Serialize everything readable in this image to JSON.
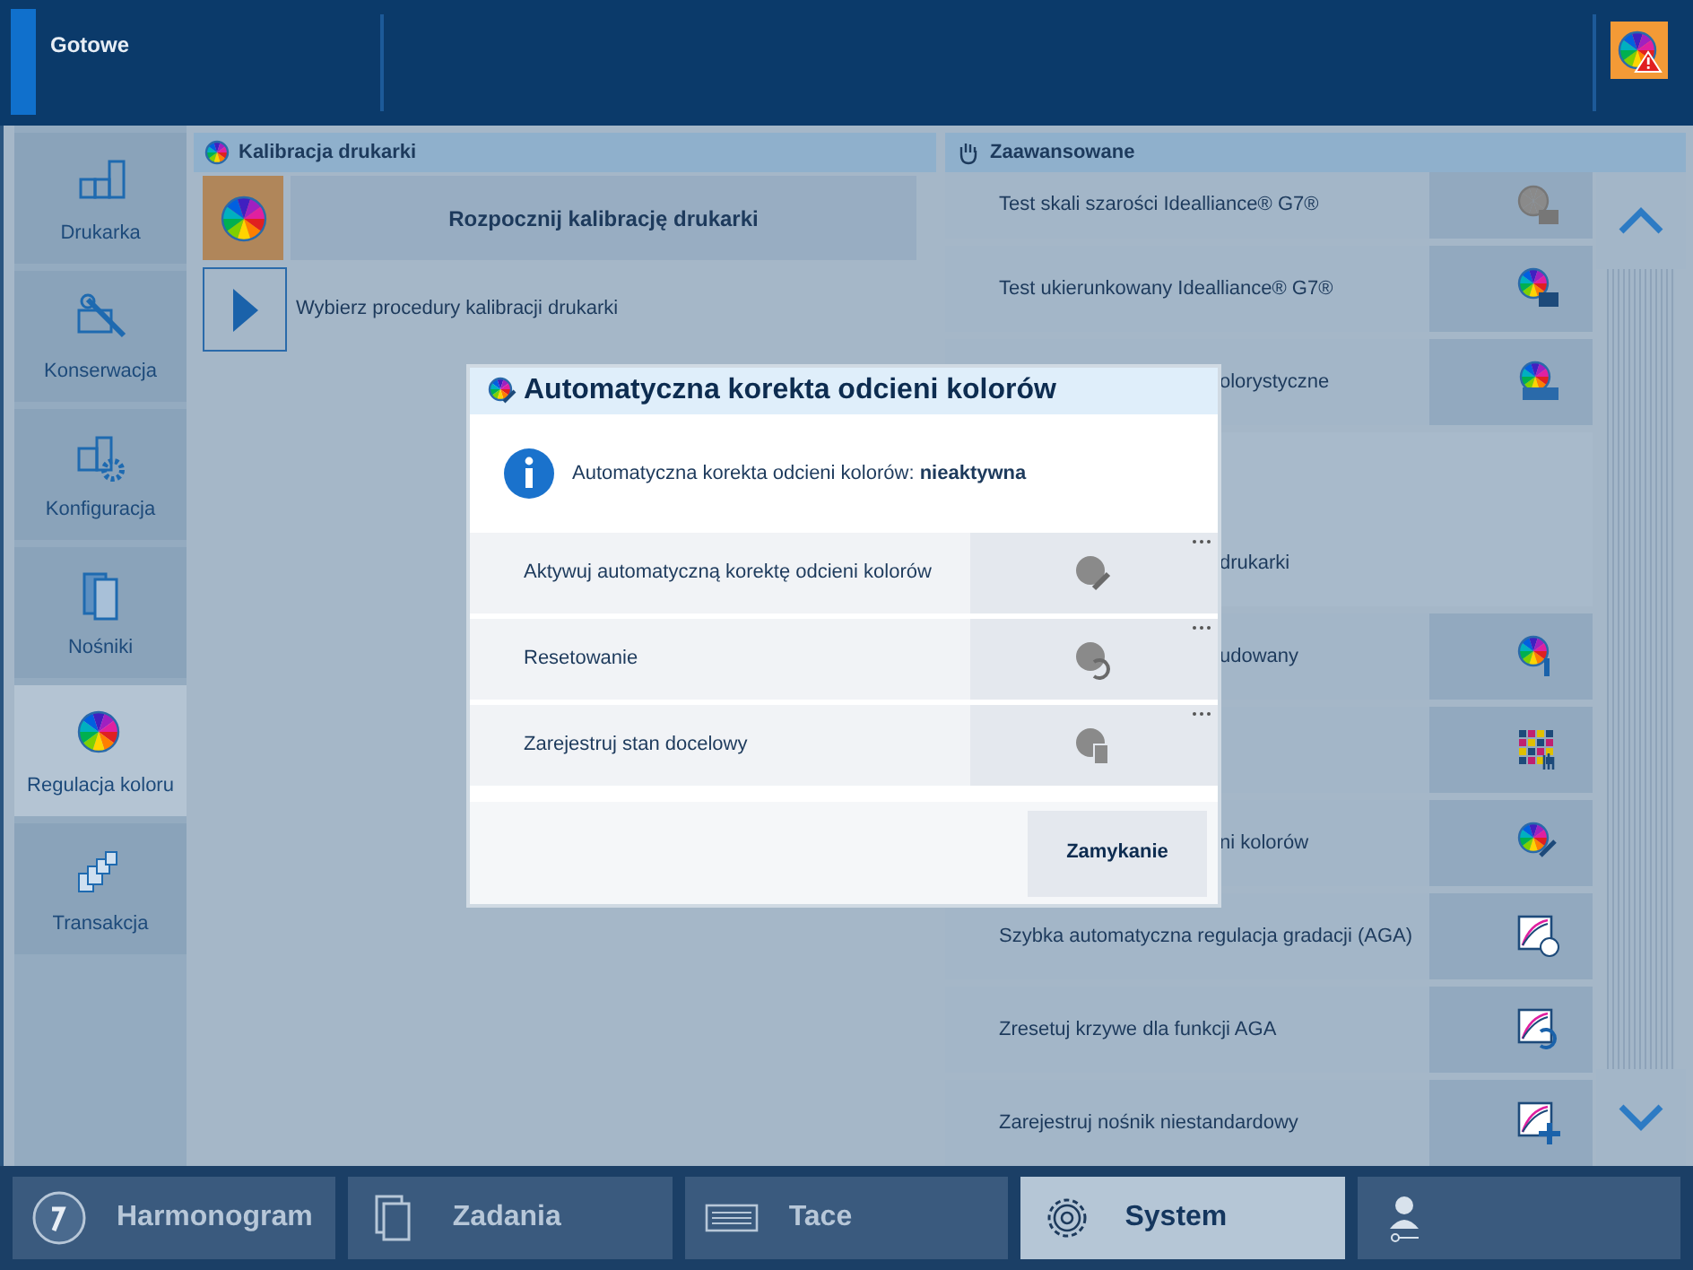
{
  "status_bar": {
    "text": "Gotowe"
  },
  "sidebar": {
    "items": [
      {
        "label": "Drukarka",
        "selected": false
      },
      {
        "label": "Konserwacja",
        "selected": false
      },
      {
        "label": "Konfiguracja",
        "selected": false
      },
      {
        "label": "Nośniki",
        "selected": false
      },
      {
        "label": "Regulacja koloru",
        "selected": true
      },
      {
        "label": "Transakcja",
        "selected": false
      }
    ]
  },
  "calibration_panel": {
    "title": "Kalibracja drukarki",
    "start_button": "Rozpocznij kalibrację drukarki",
    "link": "Wybierz procedury kalibracji drukarki"
  },
  "advanced_panel": {
    "title": "Zaawansowane",
    "rows": [
      {
        "kind": "action",
        "label": "Test skali szarości Idealliance® G7®"
      },
      {
        "kind": "action",
        "label": "Test ukierunkowany Idealliance® G7®"
      },
      {
        "kind": "covered",
        "label": "olorystyczne"
      },
      {
        "kind": "plain",
        "label": "drukarki"
      },
      {
        "kind": "covered",
        "label": "udowany"
      },
      {
        "kind": "covered"
      },
      {
        "kind": "covered",
        "label": "ni kolorów"
      },
      {
        "kind": "action",
        "label": "Szybka automatyczna regulacja gradacji (AGA)"
      },
      {
        "kind": "action",
        "label": "Zresetuj krzywe dla funkcji AGA"
      },
      {
        "kind": "action",
        "label": "Zarejestruj nośnik niestandardowy"
      }
    ]
  },
  "dialog": {
    "title": "Automatyczna korekta odcieni kolorów",
    "message": "Automatyczna korekta odcieni kolorów: **nieaktywna**",
    "actions": [
      {
        "label": "Aktywuj automatyczną korektę odcieni kolorów"
      },
      {
        "label": "Resetowanie"
      },
      {
        "label": "Zarejestruj stan docelowy"
      }
    ],
    "close_button": "Zamykanie"
  },
  "bottom_tabs": [
    {
      "label": "Harmonogram",
      "selected": false
    },
    {
      "label": "Zadania",
      "selected": false
    },
    {
      "label": "Tace",
      "selected": false
    },
    {
      "label": "System",
      "selected": true
    },
    {
      "selected": false
    }
  ]
}
